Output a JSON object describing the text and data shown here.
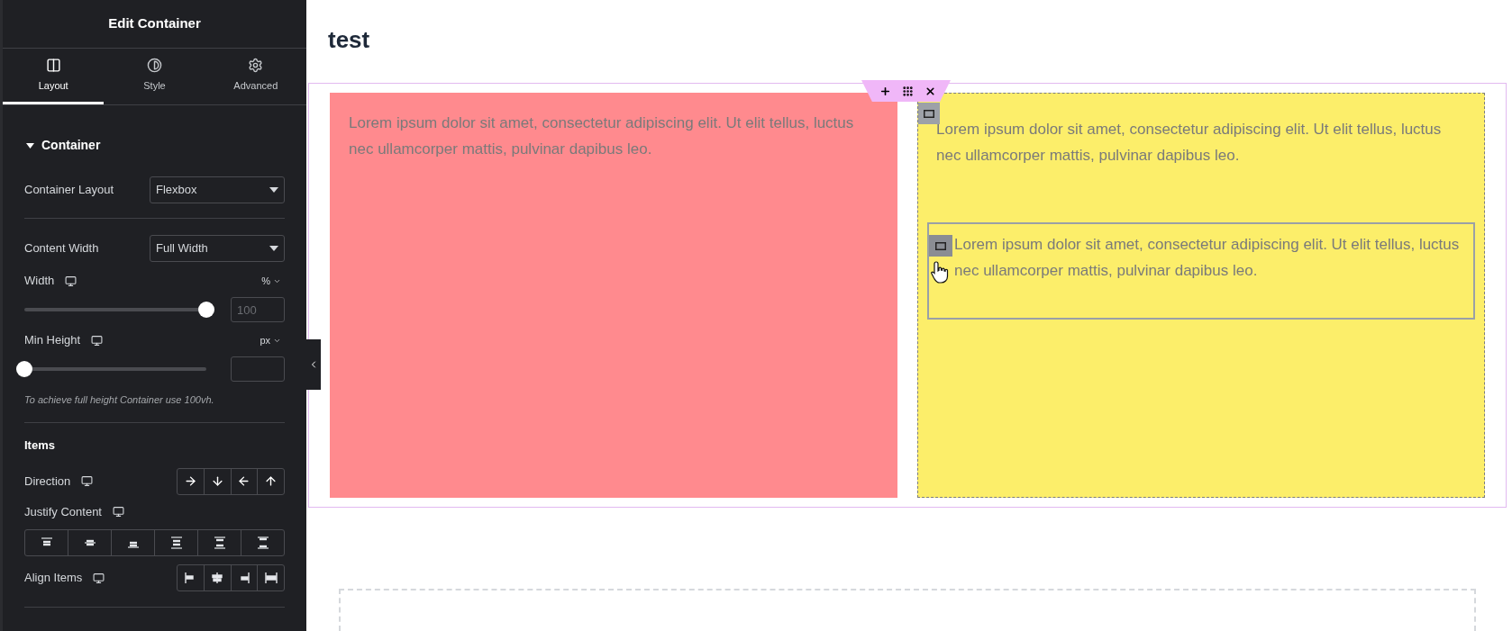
{
  "panel": {
    "title": "Edit Container",
    "tabs": [
      {
        "label": "Layout",
        "kind": "layout",
        "selected": true
      },
      {
        "label": "Style",
        "kind": "style",
        "selected": false
      },
      {
        "label": "Advanced",
        "kind": "advanced",
        "selected": false
      }
    ],
    "section": {
      "title": "Container",
      "expanded": true
    },
    "controls": [
      {
        "kind": "select",
        "label": "Container Layout",
        "value": "Flexbox"
      },
      {
        "kind": "select",
        "label": "Content Width",
        "value": "Full Width"
      },
      {
        "kind": "slider",
        "label": "Width",
        "unit": "%",
        "level": 1,
        "placeholder": "100"
      },
      {
        "kind": "slider",
        "label": "Min Height",
        "unit": "px",
        "level": 0
      },
      {
        "kind": "note",
        "text": "To achieve full height Container use 100vh."
      }
    ],
    "items_title": "Items",
    "button_groups": [
      {
        "label": "Direction",
        "kind": "direction"
      },
      {
        "label": "Justify Content",
        "kind": "justify"
      },
      {
        "label": "Align Items",
        "kind": "align"
      }
    ]
  },
  "canvas": {
    "page_title": "test",
    "columns": [
      {
        "color": "#ff8a8e",
        "selected": false,
        "widgets": [
          {
            "text": "Lorem ipsum dolor sit amet, consectetur adipiscing elit. Ut elit tellus, luctus nec ullamcorper mattis, pulvinar dapibus leo.",
            "hovered": false
          }
        ]
      },
      {
        "color": "#fcee6a",
        "selected": true,
        "widgets": [
          {
            "text": "Lorem ipsum dolor sit amet, consectetur adipiscing elit. Ut elit tellus, luctus nec ullamcorper mattis, pulvinar dapibus leo.",
            "hovered": false
          },
          {
            "text": "Lorem ipsum dolor sit amet, consectetur adipiscing elit. Ut elit tellus, luctus nec ullamcorper mattis, pulvinar dapibus leo.",
            "hovered": true
          }
        ]
      }
    ]
  }
}
